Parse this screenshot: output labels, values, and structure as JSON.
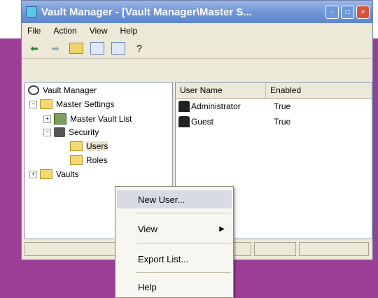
{
  "window": {
    "title": "Vault Manager - [Vault Manager\\Master S...",
    "buttons": {
      "minimize": "-",
      "maximize": "□",
      "close": "×"
    }
  },
  "menubar": [
    {
      "label": "File"
    },
    {
      "label": "Action"
    },
    {
      "label": "View"
    },
    {
      "label": "Help"
    }
  ],
  "tree": {
    "root": "Vault Manager",
    "master_settings": "Master Settings",
    "master_vault_list": "Master Vault List",
    "security": "Security",
    "users": "Users",
    "roles": "Roles",
    "vaults": "Vaults"
  },
  "list": {
    "columns": [
      "User Name",
      "Enabled"
    ],
    "rows": [
      {
        "name": "Administrator",
        "enabled": "True"
      },
      {
        "name": "Guest",
        "enabled": "True"
      }
    ]
  },
  "context_menu": {
    "new_user": "New User...",
    "view": "View",
    "export_list": "Export List...",
    "help": "Help"
  },
  "colors": {
    "background_accent": "#9b3f96",
    "titlebar": "#6e93d6"
  }
}
